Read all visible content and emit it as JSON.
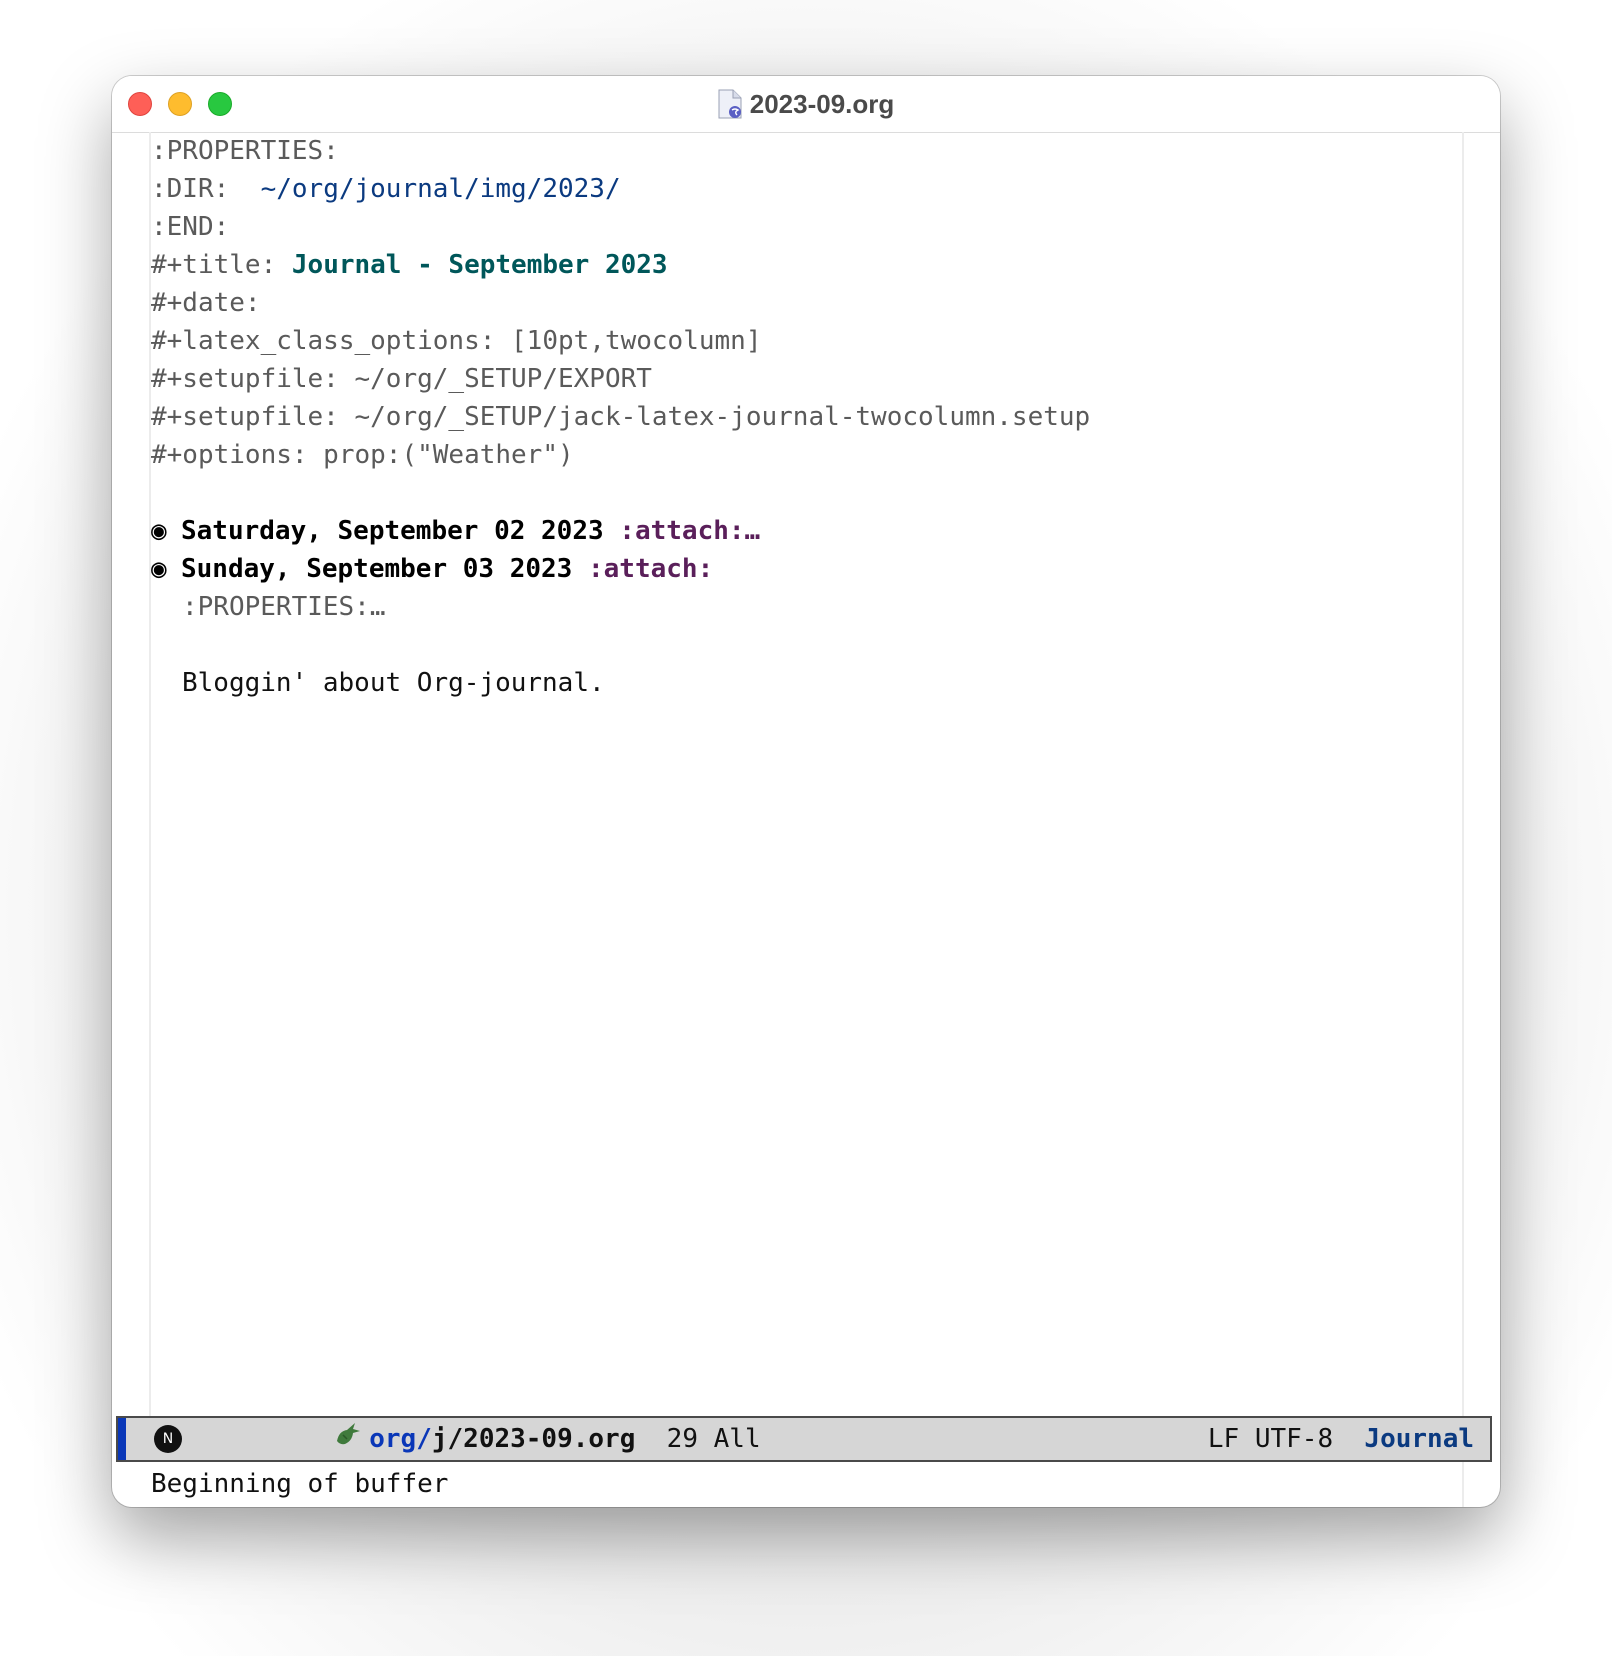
{
  "window": {
    "title": "2023-09.org",
    "traffic_lights": {
      "close": "close",
      "minimize": "minimize",
      "zoom": "zoom"
    },
    "title_icon": "emacs-document-icon"
  },
  "buffer": {
    "lines": [
      {
        "type": "meta",
        "text": ":PROPERTIES:"
      },
      {
        "type": "property",
        "key": ":DIR:  ",
        "value": "~/org/journal/img/2023/"
      },
      {
        "type": "meta",
        "text": ":END:"
      },
      {
        "type": "keyword",
        "key": "#+title: ",
        "value": "Journal - September 2023"
      },
      {
        "type": "meta",
        "text": "#+date:"
      },
      {
        "type": "meta",
        "text": "#+latex_class_options: [10pt,twocolumn]"
      },
      {
        "type": "meta",
        "text": "#+setupfile: ~/org/_SETUP/EXPORT"
      },
      {
        "type": "meta",
        "text": "#+setupfile: ~/org/_SETUP/jack-latex-journal-twocolumn.setup"
      },
      {
        "type": "meta",
        "text": "#+options: prop:(\"Weather\")"
      },
      {
        "type": "blank",
        "text": ""
      },
      {
        "type": "heading",
        "bullet": "◉",
        "text": "Saturday, September 02 2023 ",
        "tag": ":attach:…"
      },
      {
        "type": "heading",
        "bullet": "◉",
        "text": "Sunday, September 03 2023 ",
        "tag": ":attach:"
      },
      {
        "type": "drawer",
        "text": ":PROPERTIES:…"
      },
      {
        "type": "blank",
        "text": ""
      },
      {
        "type": "body",
        "text": "Bloggin' about Org-journal."
      }
    ]
  },
  "modeline": {
    "state_badge": "N",
    "major_icon": "gnu-icon",
    "dir": "org/",
    "file": "j/2023-09.org",
    "position": "29 All",
    "encoding": "LF UTF-8",
    "mode": "Journal",
    "colors": {
      "accent": "#0a37b8",
      "mode": "#0b3a80"
    }
  },
  "echo_area": {
    "message": "Beginning of buffer"
  }
}
